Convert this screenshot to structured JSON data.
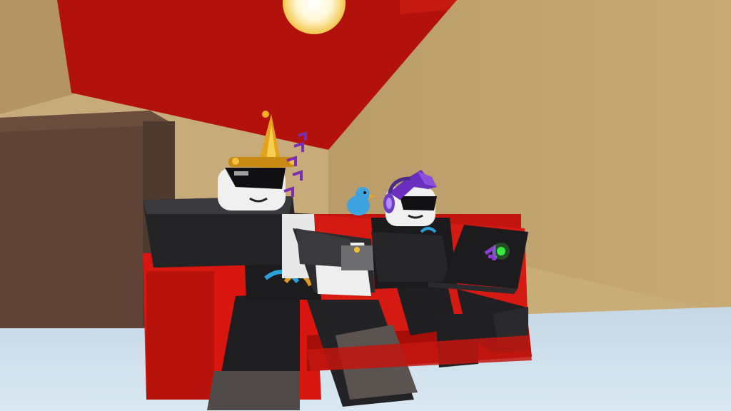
{
  "scene": {
    "title": "",
    "description_text": ""
  },
  "palette": {
    "ceiling": "#b3120c",
    "wall_left": "#c9ad7c",
    "wall_right": "#c6a771",
    "floor": "#cfe0ec",
    "couch": "#d41a12",
    "cabinet": "#5e4336",
    "suit": "#1f1f21",
    "skin": "#f2f2f2",
    "crown_gold": "#e2a21c",
    "notes_purple": "#7b2fb0",
    "bird_blue": "#3fa3e0",
    "hair_purple": "#6a2fbf",
    "laptop": "#1c1c1f",
    "laptop_logo": "#8d3bd6",
    "laptop_light": "#39e83a"
  },
  "characters": [
    {
      "role": "left-avatar",
      "accessories": [
        "crown-icon",
        "sunglasses-icon",
        "music-notes-icon"
      ]
    },
    {
      "role": "right-avatar",
      "accessories": [
        "headphones-icon",
        "sunglasses-icon",
        "laptop-icon"
      ]
    }
  ],
  "props": [
    "ceiling-light",
    "cabinet",
    "red-couch",
    "blue-bird"
  ]
}
